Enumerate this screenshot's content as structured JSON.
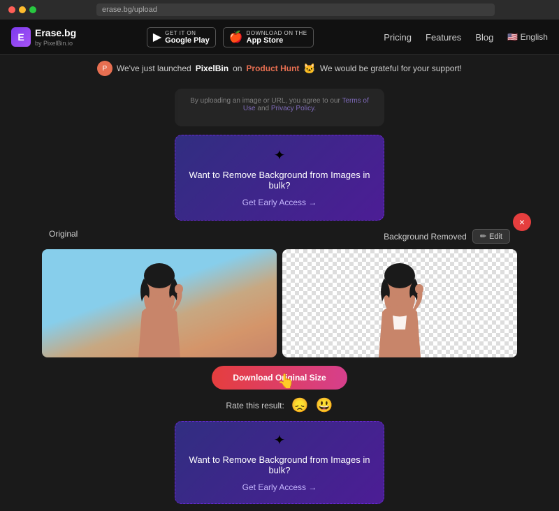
{
  "browser": {
    "url": "erase.bg/upload"
  },
  "nav": {
    "logo_icon": "E",
    "logo_name": "Erase.bg",
    "logo_sub": "by PixelBin.io",
    "google_play_sub": "GET IT ON",
    "google_play_name": "Google Play",
    "app_store_sub": "Download on the",
    "app_store_name": "App Store",
    "links": [
      "Pricing",
      "Features",
      "Blog"
    ],
    "lang": "🇺🇸 English"
  },
  "ph_banner": {
    "text1": "We've just launched",
    "brand": "PixelBin",
    "text2": "on",
    "link": "Product Hunt",
    "text3": "We would be grateful for your support!"
  },
  "upload": {
    "terms_text": "By uploading an image or URL, you agree to our",
    "terms_link": "Terms of Use",
    "and": "and",
    "privacy": "Privacy Policy."
  },
  "bulk_top": {
    "icon": "✦",
    "title": "Want to Remove Background from Images in bulk?",
    "cta": "Get Early Access →"
  },
  "results": {
    "original_label": "Original",
    "removed_label": "Background Removed",
    "edit_icon": "✏",
    "edit_label": "Edit"
  },
  "download": {
    "label": "Download Original Size"
  },
  "rating": {
    "label": "Rate this result:",
    "sad": "😞",
    "happy": "😃"
  },
  "bulk_bottom": {
    "icon": "✦",
    "title": "Want to Remove Background from Images in bulk?",
    "cta": "Get Early Access →"
  },
  "close": {
    "label": "×"
  }
}
